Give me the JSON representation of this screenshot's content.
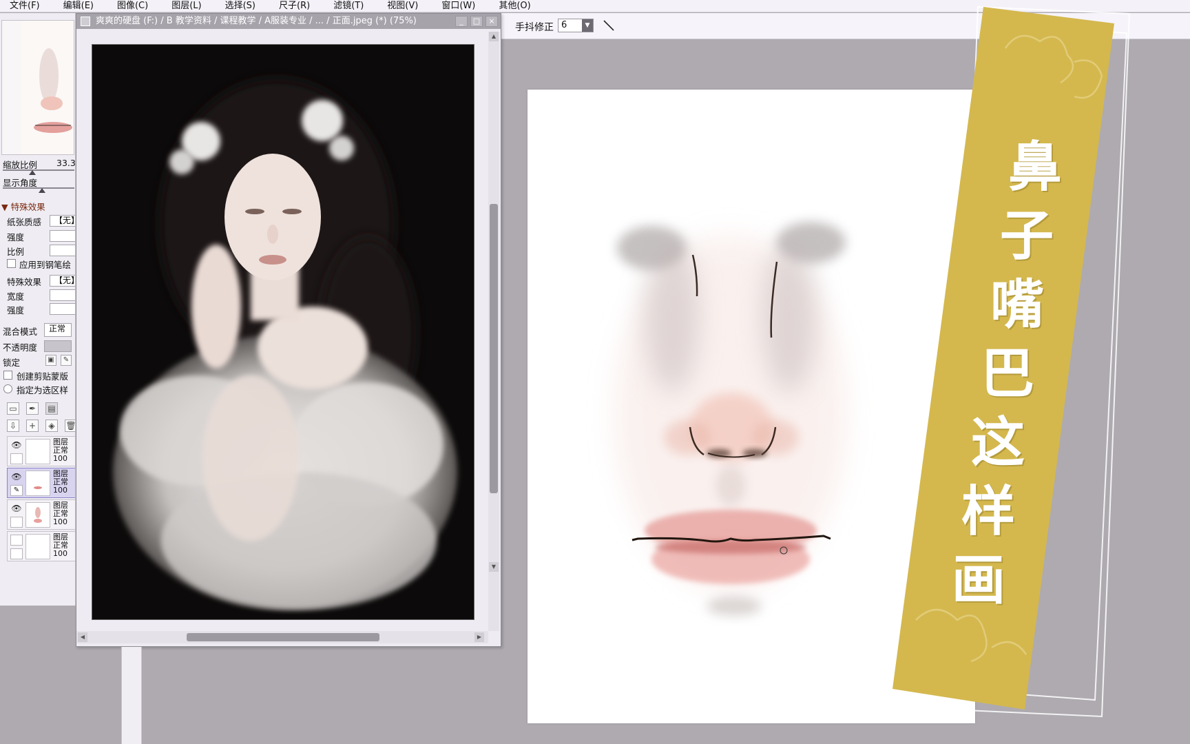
{
  "menu": {
    "items": [
      "文件(F)",
      "编辑(E)",
      "图像(C)",
      "图层(L)",
      "选择(S)",
      "尺子(R)",
      "滤镜(T)",
      "视图(V)",
      "窗口(W)",
      "其他(O)"
    ]
  },
  "toolbar": {
    "stabilizer_label": "手抖修正",
    "stabilizer_value": "6"
  },
  "left_panel": {
    "zoom_label": "缩放比例",
    "zoom_value": "33.3",
    "angle_label": "显示角度",
    "special_section": "特殊效果",
    "paper_texture_label": "纸张质感",
    "paper_texture_value": "【无】",
    "strength_label": "强度",
    "scale_label": "比例",
    "apply_brush_label": "应用到钢笔绘",
    "effect_label": "特殊效果",
    "effect_value": "【无】",
    "width_label": "宽度",
    "strength2_label": "强度",
    "blend_label": "混合模式",
    "blend_value": "正常",
    "opacity_label": "不透明度",
    "lock_label": "锁定",
    "clip_label": "创建剪贴蒙版",
    "selection_label": "指定为选区样",
    "layers": [
      {
        "name": "图层",
        "mode": "正常",
        "opacity": "100"
      },
      {
        "name": "图层",
        "mode": "正常",
        "opacity": "100"
      },
      {
        "name": "图层",
        "mode": "正常",
        "opacity": "100"
      },
      {
        "name": "图层",
        "mode": "正常",
        "opacity": "100"
      }
    ]
  },
  "reference_window": {
    "title": "爽爽的硬盘 (F:) / B 教学资料 / 课程教学 / A服装专业 / ... / 正面.jpeg (*) (75%)"
  },
  "banner": {
    "chars": [
      "鼻",
      "子",
      "嘴",
      "巴",
      "这",
      "样",
      "画"
    ],
    "color": "#d4b84e"
  },
  "colors": {
    "workspace": "#aeaab0",
    "panel": "#efedf3",
    "accent_gold": "#d4b84e"
  }
}
